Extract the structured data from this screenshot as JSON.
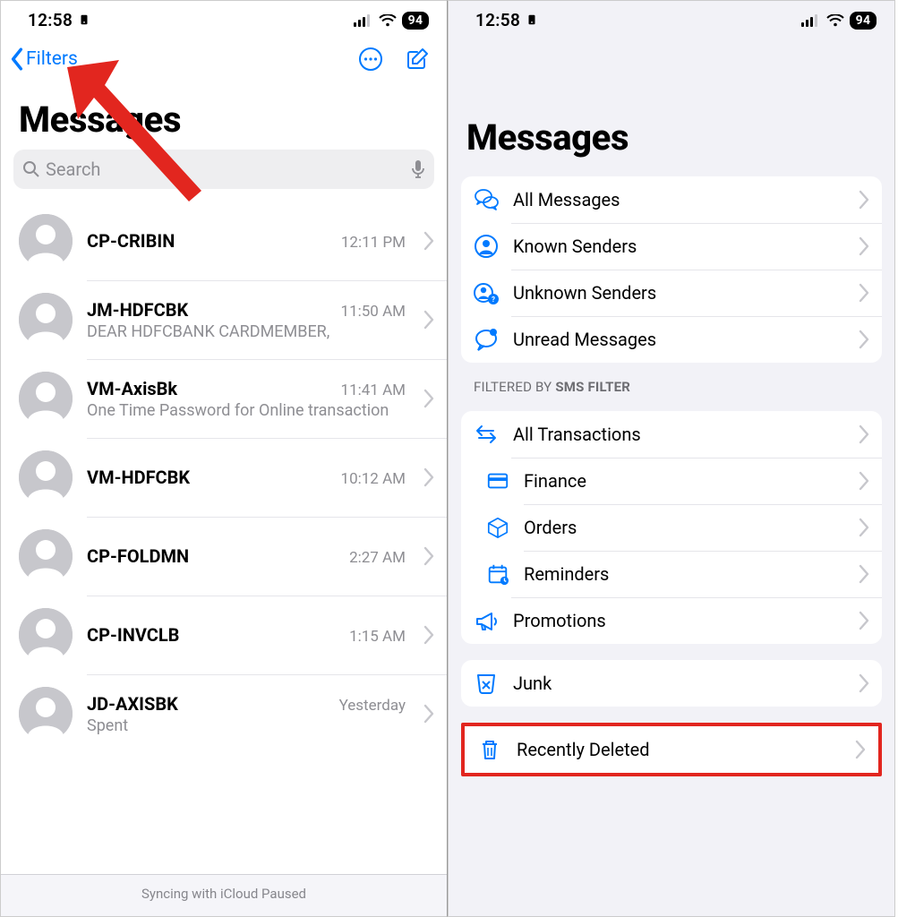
{
  "status": {
    "time": "12:58",
    "battery": "94"
  },
  "left": {
    "back_label": "Filters",
    "title": "Messages",
    "search_placeholder": "Search",
    "sync_status": "Syncing with iCloud Paused",
    "conversations": [
      {
        "name": "CP-CRIBIN",
        "time": "12:11 PM",
        "preview": ""
      },
      {
        "name": "JM-HDFCBK",
        "time": "11:50 AM",
        "preview": "DEAR HDFCBANK CARDMEMBER,"
      },
      {
        "name": "VM-AxisBk",
        "time": "11:41 AM",
        "preview": "One Time Password for Online transaction"
      },
      {
        "name": "VM-HDFCBK",
        "time": "10:12 AM",
        "preview": ""
      },
      {
        "name": "CP-FOLDMN",
        "time": "2:27 AM",
        "preview": ""
      },
      {
        "name": "CP-INVCLB",
        "time": "1:15 AM",
        "preview": ""
      },
      {
        "name": "JD-AXISBK",
        "time": "Yesterday",
        "preview": "Spent"
      }
    ]
  },
  "right": {
    "title": "Messages",
    "group1": [
      {
        "icon": "bubbles",
        "label": "All Messages"
      },
      {
        "icon": "person-circle",
        "label": "Known Senders"
      },
      {
        "icon": "person-question",
        "label": "Unknown Senders"
      },
      {
        "icon": "bubble-dot",
        "label": "Unread Messages"
      }
    ],
    "filtered_header_prefix": "FILTERED BY ",
    "filtered_header_bold": "SMS FILTER",
    "group2": [
      {
        "icon": "arrows",
        "label": "All Transactions",
        "sub": false
      },
      {
        "icon": "card",
        "label": "Finance",
        "sub": true
      },
      {
        "icon": "box",
        "label": "Orders",
        "sub": true
      },
      {
        "icon": "calendar",
        "label": "Reminders",
        "sub": true
      },
      {
        "icon": "megaphone",
        "label": "Promotions",
        "sub": false
      }
    ],
    "junk": {
      "icon": "junk",
      "label": "Junk"
    },
    "deleted": {
      "icon": "trash",
      "label": "Recently Deleted"
    }
  }
}
